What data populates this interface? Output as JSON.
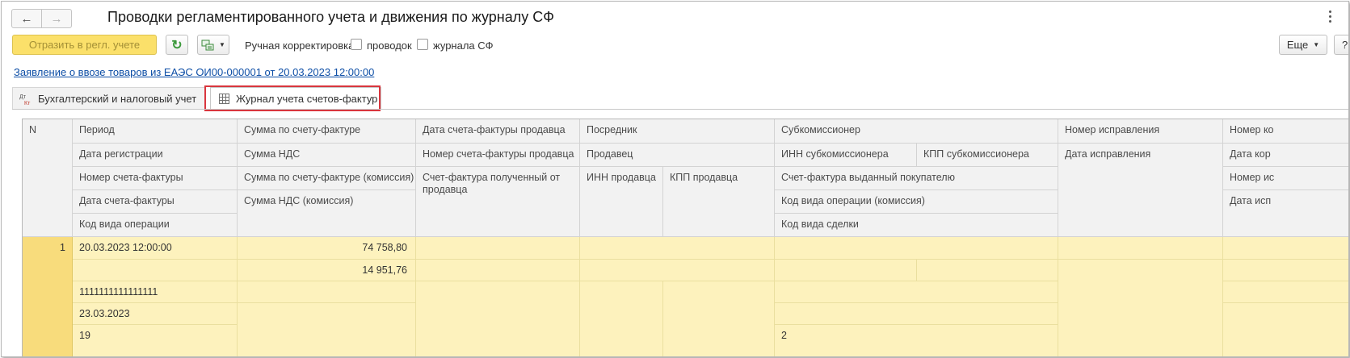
{
  "window": {
    "title": "Проводки регламентированного учета и движения по журналу СФ",
    "back_icon": "arrow-left-icon",
    "forward_icon": "arrow-right-icon"
  },
  "toolbar": {
    "reflect_label": "Отразить в регл. учете",
    "manual_label": "Ручная корректировка:",
    "cb_postings_label": "проводок",
    "cb_journal_label": "журнала СФ",
    "cb_postings_checked": false,
    "cb_journal_checked": false,
    "more_label": "Еще",
    "help_label": "?"
  },
  "doc_link": "Заявление о ввозе товаров из ЕАЭС ОИ00-000001 от 20.03.2023 12:00:00",
  "tabs": [
    {
      "label": "Бухгалтерский и налоговый учет",
      "icon": "dt-kt-icon",
      "active": false
    },
    {
      "label": "Журнал учета счетов-фактур",
      "icon": "table-icon",
      "active": true
    }
  ],
  "grid": {
    "headers": {
      "n": "N",
      "period": "Период",
      "reg_date": "Дата регистрации",
      "invoice_number": "Номер счета-фактуры",
      "invoice_date": "Дата счета-фактуры",
      "operation_code": "Код вида операции",
      "invoice_sum": "Сумма по счету-фактуре",
      "vat_sum": "Сумма НДС",
      "invoice_sum_commission": "Сумма по счету-фактуре (комиссия)",
      "vat_sum_commission": "Сумма НДС (комиссия)",
      "seller_invoice_date": "Дата счета-фактуры продавца",
      "seller_invoice_number": "Номер счета-фактуры продавца",
      "invoice_received": "Счет-фактура полученный от продавца",
      "intermediary": "Посредник",
      "seller": "Продавец",
      "seller_inn": "ИНН продавца",
      "seller_kpp": "КПП продавца",
      "subcommissioner": "Субкомиссионер",
      "sub_inn": "ИНН субкомиссионера",
      "sub_kpp": "КПП субкомиссионера",
      "invoice_issued": "Счет-фактура выданный покупателю",
      "operation_code_commission": "Код вида операции (комиссия)",
      "deal_code": "Код вида сделки",
      "correction_number": "Номер исправления",
      "correction_date": "Дата исправления",
      "adj_number": "Номер ко",
      "adj_date": "Дата кор",
      "adj_corr_number": "Номер ис",
      "adj_corr_date": "Дата исп"
    },
    "row": {
      "n": "1",
      "period": "20.03.2023 12:00:00",
      "invoice_sum": "74 758,80",
      "vat_sum": "14 951,76",
      "invoice_number": "1111111111111111",
      "invoice_date": "23.03.2023",
      "operation_code": "19",
      "deal_code": "2"
    }
  },
  "colors": {
    "accent_button": "#fbe06a",
    "row_background": "#fdf2bd",
    "row_number_cell": "#f8dc7c",
    "highlight_border": "#d9363e",
    "link": "#0d4ea6"
  }
}
